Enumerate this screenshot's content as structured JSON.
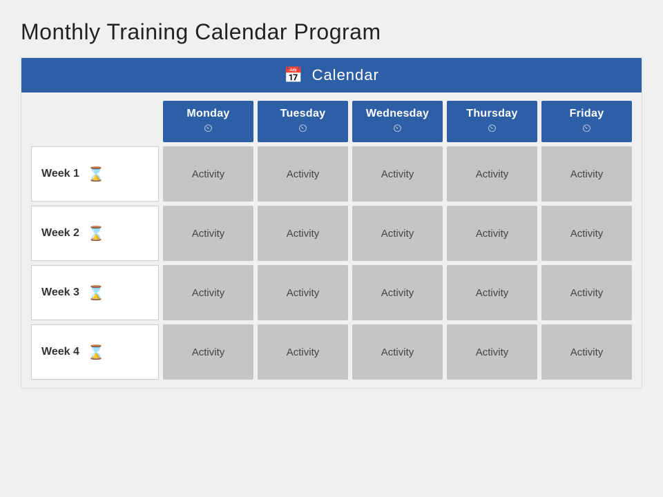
{
  "page": {
    "title": "Monthly Training Calendar Program",
    "calendarLabel": "Calendar",
    "calendarIcon": "📅",
    "days": [
      {
        "name": "Monday",
        "icon": "⏱"
      },
      {
        "name": "Tuesday",
        "icon": "⏱"
      },
      {
        "name": "Wednesday",
        "icon": "⏱"
      },
      {
        "name": "Thursday",
        "icon": "⏱"
      },
      {
        "name": "Friday",
        "icon": "⏱"
      }
    ],
    "weeks": [
      {
        "label": "Week 1",
        "activities": [
          "Activity",
          "Activity",
          "Activity",
          "Activity",
          "Activity"
        ]
      },
      {
        "label": "Week 2",
        "activities": [
          "Activity",
          "Activity",
          "Activity",
          "Activity",
          "Activity"
        ]
      },
      {
        "label": "Week 3",
        "activities": [
          "Activity",
          "Activity",
          "Activity",
          "Activity",
          "Activity"
        ]
      },
      {
        "label": "Week 4",
        "activities": [
          "Activity",
          "Activity",
          "Activity",
          "Activity",
          "Activity"
        ]
      }
    ]
  }
}
